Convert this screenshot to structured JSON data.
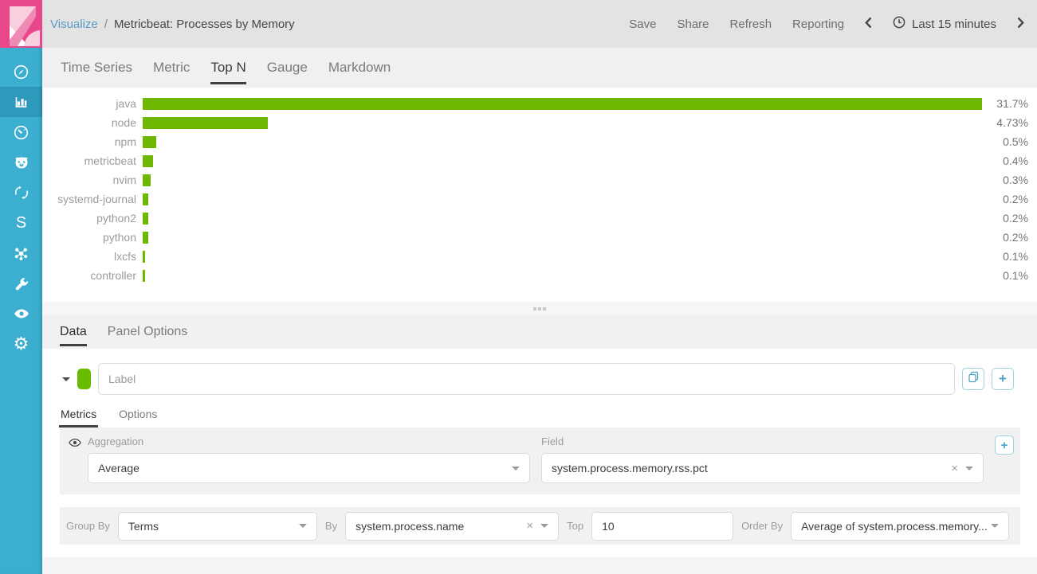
{
  "header": {
    "breadcrumb": {
      "section": "Visualize",
      "separator": "/",
      "title": "Metricbeat: Processes by Memory"
    },
    "actions": [
      "Save",
      "Share",
      "Refresh",
      "Reporting"
    ],
    "time_picker": {
      "clock_icon": "clock-icon",
      "label": "Last 15 minutes",
      "prev_icon": "chevron-left-icon",
      "next_icon": "chevron-right-icon"
    }
  },
  "sidebar": {
    "logo_icon": "kibana-logo",
    "items": [
      {
        "icon": "discover-compass-icon",
        "active": false
      },
      {
        "icon": "visualize-bar-chart-icon",
        "active": true
      },
      {
        "icon": "dashboard-gauge-icon",
        "active": false
      },
      {
        "icon": "timelion-lion-icon",
        "active": false
      },
      {
        "icon": "apm-arrows-icon",
        "active": false
      },
      {
        "icon": "letter-s-icon",
        "active": false,
        "glyph": "S"
      },
      {
        "icon": "graph-network-icon",
        "active": false
      },
      {
        "icon": "dev-tools-wrench-icon",
        "active": false
      },
      {
        "icon": "monitoring-eye-icon",
        "active": false
      },
      {
        "icon": "management-gear-icon",
        "active": false,
        "glyph": "⚙"
      }
    ]
  },
  "viz_tabs": [
    {
      "label": "Time Series",
      "active": false
    },
    {
      "label": "Metric",
      "active": false
    },
    {
      "label": "Top N",
      "active": true
    },
    {
      "label": "Gauge",
      "active": false
    },
    {
      "label": "Markdown",
      "active": false
    }
  ],
  "chart_data": {
    "type": "bar",
    "orientation": "horizontal",
    "title": "",
    "xlabel": "",
    "ylabel": "",
    "unit": "%",
    "grid": false,
    "xlim": [
      0,
      31.7
    ],
    "categories": [
      "java",
      "node",
      "npm",
      "metricbeat",
      "nvim",
      "systemd-journal",
      "python2",
      "python",
      "lxcfs",
      "controller"
    ],
    "values": [
      31.7,
      4.73,
      0.5,
      0.4,
      0.3,
      0.2,
      0.2,
      0.2,
      0.1,
      0.1
    ],
    "value_labels": [
      "31.7%",
      "4.73%",
      "0.5%",
      "0.4%",
      "0.3%",
      "0.2%",
      "0.2%",
      "0.2%",
      "0.1%",
      "0.1%"
    ],
    "bar_color": "#6eb700"
  },
  "editor_tabs": [
    {
      "label": "Data",
      "active": true
    },
    {
      "label": "Panel Options",
      "active": false
    }
  ],
  "series": {
    "collapse_icon": "caret-down-icon",
    "color_swatch": "#68bc00",
    "label_placeholder": "Label",
    "clone_icon": "clone-icon",
    "add_icon": "plus-icon"
  },
  "series_tabs": [
    {
      "label": "Metrics",
      "active": true
    },
    {
      "label": "Options",
      "active": false
    }
  ],
  "metrics_row": {
    "eye_icon": "eye-icon",
    "aggregation_label": "Aggregation",
    "aggregation_value": "Average",
    "field_label": "Field",
    "field_value": "system.process.memory.rss.pct",
    "clear_icon": "×",
    "add_icon": "plus-icon",
    "add_glyph": "+"
  },
  "group_by_row": {
    "group_by_label": "Group By",
    "group_by_value": "Terms",
    "by_label": "By",
    "by_value": "system.process.name",
    "clear_icon": "×",
    "top_label": "Top",
    "top_value": "10",
    "order_by_label": "Order By",
    "order_by_value": "Average of system.process.memory..."
  },
  "misc": {
    "drag_handle_icon": "drag-handle-dots-icon"
  },
  "colors": {
    "sidebar": "#3cafd1",
    "sidebar_active": "#2d9abc",
    "logo_pink": "#e8488b",
    "header_gray": "#e3e3e3",
    "accent_green": "#68bc00",
    "link_blue": "#5899c7",
    "button_blue": "#4ba3c6"
  }
}
